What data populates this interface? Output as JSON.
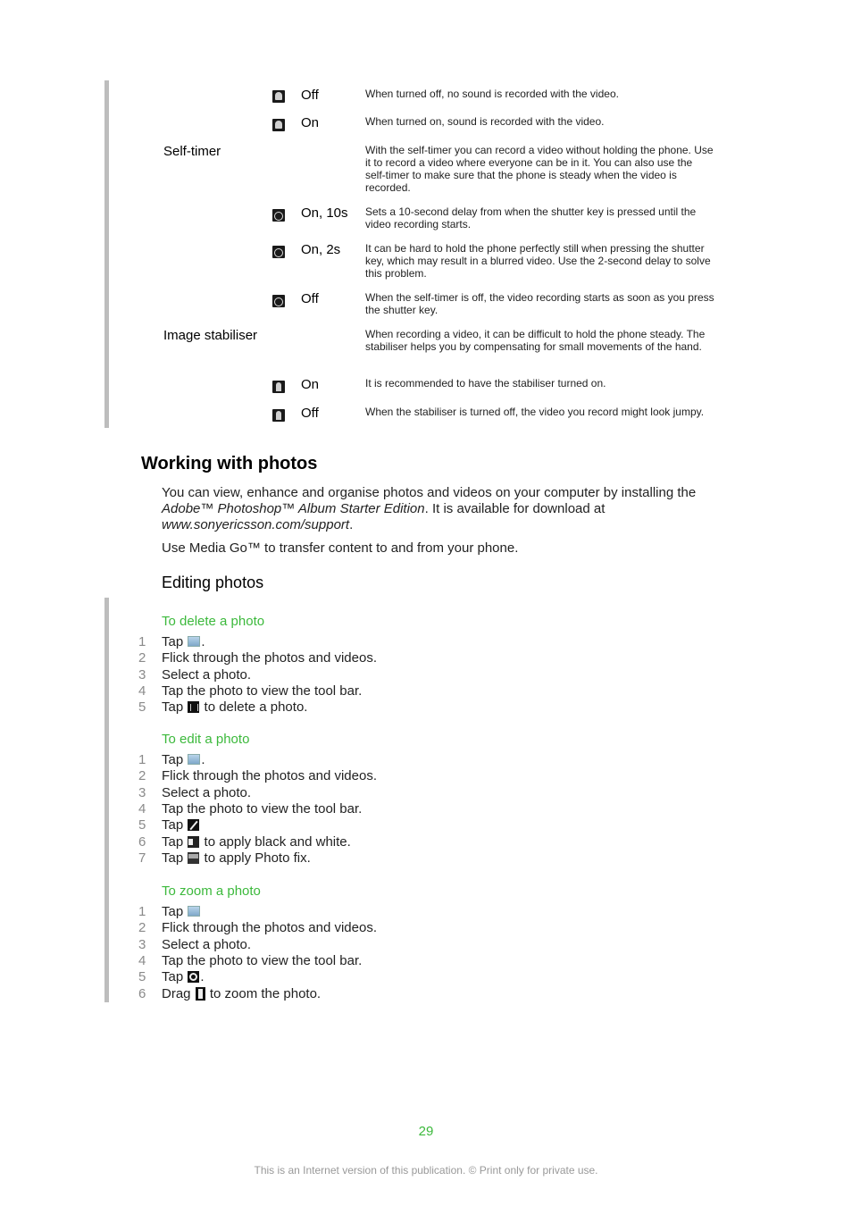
{
  "settings_table": {
    "rows": [
      {
        "type": "option",
        "icon": "microphone-off-icon",
        "label": "Off",
        "desc": "When turned off, no sound is recorded with the video."
      },
      {
        "type": "option",
        "icon": "microphone-on-icon",
        "label": "On",
        "desc": "When turned on, sound is recorded with the video."
      },
      {
        "type": "setting",
        "label": "Self-timer",
        "desc": "With the self-timer you can record a video without holding the phone. Use it to record a video where everyone can be in it. You can also use the self-timer to make sure that the phone is steady when the video is recorded."
      },
      {
        "type": "option",
        "icon": "self-timer-10s-icon",
        "label": "On, 10s",
        "desc": "Sets a 10-second delay from when the shutter key is pressed until the video recording starts."
      },
      {
        "type": "option",
        "icon": "self-timer-2s-icon",
        "label": "On, 2s",
        "desc": "It can be hard to hold the phone perfectly still when pressing the shutter key, which may result in a blurred video. Use the 2-second delay to solve this problem."
      },
      {
        "type": "option",
        "icon": "self-timer-off-icon",
        "label": "Off",
        "desc": "When the self-timer is off, the video recording starts as soon as you press the shutter key."
      },
      {
        "type": "setting",
        "label": "Image stabiliser",
        "desc": "When recording a video, it can be difficult to hold the phone steady. The stabiliser helps you by compensating for small movements of the hand."
      },
      {
        "type": "option",
        "icon": "stabiliser-on-icon",
        "label": "On",
        "desc": "It is recommended to have the stabiliser turned on."
      },
      {
        "type": "option",
        "icon": "stabiliser-off-icon",
        "label": "Off",
        "desc": "When the stabiliser is turned off, the video you record might look jumpy."
      }
    ]
  },
  "section": {
    "title": "Working with photos",
    "intro_part1": "You can view, enhance and organise photos and videos on your computer by installing the ",
    "intro_italic1": "Adobe™ Photoshop™ Album Starter Edition",
    "intro_part2": ". It is available for download at ",
    "intro_italic2": "www.sonyericsson.com/support",
    "intro_part3": ".",
    "para2": "Use Media Go™ to transfer content to and from your phone.",
    "subtitle": "Editing photos"
  },
  "procedures": {
    "delete": {
      "title": "To delete a photo",
      "steps": [
        {
          "n": "1",
          "pre": "Tap ",
          "icon": "gallery",
          "post": "."
        },
        {
          "n": "2",
          "pre": "Flick through the photos and videos.",
          "icon": "",
          "post": ""
        },
        {
          "n": "3",
          "pre": "Select a photo.",
          "icon": "",
          "post": ""
        },
        {
          "n": "4",
          "pre": "Tap the photo to view the tool bar.",
          "icon": "",
          "post": ""
        },
        {
          "n": "5",
          "pre": "Tap ",
          "icon": "trash",
          "post": " to delete a photo."
        }
      ]
    },
    "edit": {
      "title": "To edit a photo",
      "steps": [
        {
          "n": "1",
          "pre": "Tap ",
          "icon": "gallery",
          "post": "."
        },
        {
          "n": "2",
          "pre": "Flick through the photos and videos.",
          "icon": "",
          "post": ""
        },
        {
          "n": "3",
          "pre": "Select a photo.",
          "icon": "",
          "post": ""
        },
        {
          "n": "4",
          "pre": "Tap the photo to view the tool bar.",
          "icon": "",
          "post": ""
        },
        {
          "n": "5",
          "pre": "Tap ",
          "icon": "pencil",
          "post": ""
        },
        {
          "n": "6",
          "pre": "Tap ",
          "icon": "bw",
          "post": " to apply black and white."
        },
        {
          "n": "7",
          "pre": "Tap ",
          "icon": "fix",
          "post": " to apply Photo fix."
        }
      ]
    },
    "zoom": {
      "title": "To zoom a photo",
      "steps": [
        {
          "n": "1",
          "pre": "Tap ",
          "icon": "gallery",
          "post": ""
        },
        {
          "n": "2",
          "pre": "Flick through the photos and videos.",
          "icon": "",
          "post": ""
        },
        {
          "n": "3",
          "pre": "Select a photo.",
          "icon": "",
          "post": ""
        },
        {
          "n": "4",
          "pre": "Tap the photo to view the tool bar.",
          "icon": "",
          "post": ""
        },
        {
          "n": "5",
          "pre": "Tap ",
          "icon": "zoom",
          "post": "."
        },
        {
          "n": "6",
          "pre": "Drag ",
          "icon": "handle",
          "post": " to zoom the photo."
        }
      ]
    }
  },
  "footer": {
    "page_number": "29",
    "notice": "This is an Internet version of this publication. © Print only for private use."
  },
  "colors": {
    "accent_green": "#3cb93c",
    "sidebar_bar": "#bdbdbd"
  }
}
